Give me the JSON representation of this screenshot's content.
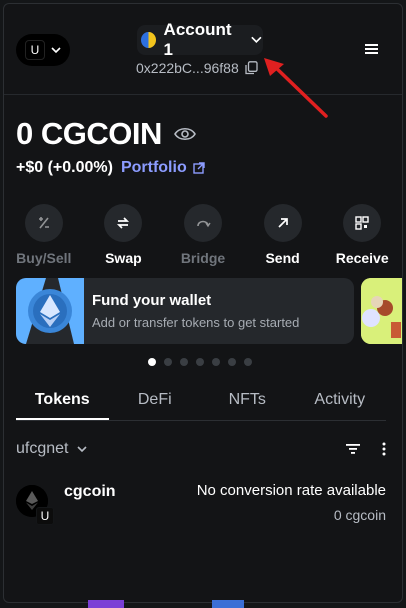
{
  "header": {
    "network_avatar": "U",
    "account_name": "Account 1",
    "address": "0x222bC...96f88"
  },
  "balance": {
    "amount": "0 CGCOIN",
    "change": "+$0 (+0.00%)",
    "portfolio_label": "Portfolio"
  },
  "actions": [
    {
      "label": "Buy/Sell",
      "icon": "buy-sell-icon",
      "enabled": false
    },
    {
      "label": "Swap",
      "icon": "swap-icon",
      "enabled": true
    },
    {
      "label": "Bridge",
      "icon": "bridge-icon",
      "enabled": false
    },
    {
      "label": "Send",
      "icon": "send-icon",
      "enabled": true
    },
    {
      "label": "Receive",
      "icon": "receive-icon",
      "enabled": true
    }
  ],
  "carousel": {
    "title": "Fund your wallet",
    "subtitle": "Add or transfer tokens to get started",
    "slide_count": 7,
    "active_index": 0
  },
  "tabs": [
    "Tokens",
    "DeFi",
    "NFTs",
    "Activity"
  ],
  "active_tab": "Tokens",
  "network_filter": "ufcgnet",
  "tokens": [
    {
      "name": "cgcoin",
      "rate_text": "No conversion rate available",
      "amount": "0 cgcoin",
      "badge": "U"
    }
  ],
  "colors": {
    "background": "#131416",
    "accent_link": "#8c9cff",
    "card": "#25282c",
    "annotation_arrow": "#e02020"
  }
}
